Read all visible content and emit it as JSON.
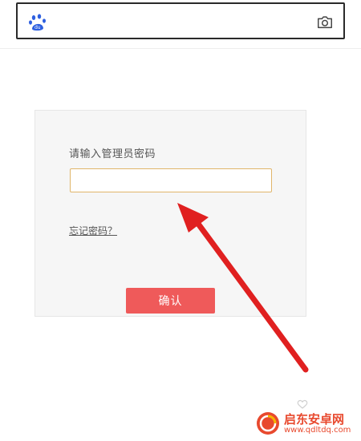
{
  "search_bar": {
    "logo_icon": "baidu-paw-icon",
    "camera_icon": "camera-icon"
  },
  "login": {
    "prompt_label": "请输入管理员密码",
    "password_value": "",
    "forgot_link": "忘记密码？",
    "confirm_label": "确认"
  },
  "annotation": {
    "arrow_icon": "red-arrow-pointer",
    "color": "#e02020"
  },
  "watermark": {
    "title": "启东安卓网",
    "url": "www.qdltdq.com",
    "color": "#e8492e"
  },
  "colors": {
    "accent": "#ef5a5a",
    "input_border": "#e0b56a",
    "baidu_blue": "#2d5fe0"
  }
}
